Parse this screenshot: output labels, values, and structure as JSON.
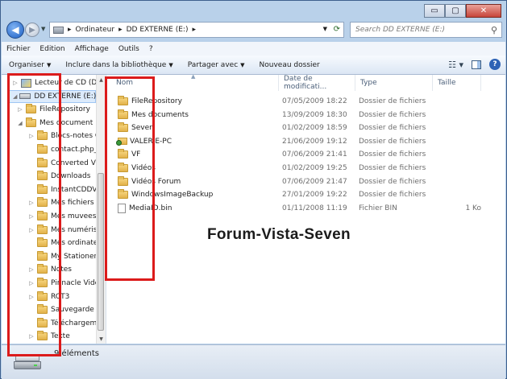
{
  "window": {
    "caption_buttons": {
      "minimize": "▭",
      "maximize": "▢",
      "close": "✕"
    }
  },
  "address_bar": {
    "crumbs": [
      "Ordinateur",
      "DD EXTERNE (E:)"
    ],
    "separator": "▸",
    "search_placeholder": "Search DD EXTERNE (E:)"
  },
  "menu": [
    "Fichier",
    "Edition",
    "Affichage",
    "Outils",
    "?"
  ],
  "commands": [
    {
      "label": "Organiser",
      "dropdown": true
    },
    {
      "label": "Inclure dans la bibliothèque",
      "dropdown": true
    },
    {
      "label": "Partager avec",
      "dropdown": true
    },
    {
      "label": "Nouveau dossier",
      "dropdown": false
    }
  ],
  "nav_tree": [
    {
      "label": "Lecteur de CD (D",
      "icon": "cd-drive",
      "indent": 0,
      "expander": "▷",
      "selected": false
    },
    {
      "label": "DD EXTERNE (E:)",
      "icon": "external-drive",
      "indent": 0,
      "expander": "◢",
      "selected": true
    },
    {
      "label": "FileRepository",
      "icon": "folder",
      "indent": 1,
      "expander": "▷",
      "selected": false
    },
    {
      "label": "Mes document",
      "icon": "folder",
      "indent": 1,
      "expander": "◢",
      "selected": false
    },
    {
      "label": "Blocs-notes C",
      "icon": "folder",
      "indent": 2,
      "expander": "▷",
      "selected": false
    },
    {
      "label": "contact.php_",
      "icon": "folder",
      "indent": 2,
      "expander": "",
      "selected": false
    },
    {
      "label": "Converted Vi",
      "icon": "folder",
      "indent": 2,
      "expander": "",
      "selected": false
    },
    {
      "label": "Downloads",
      "icon": "folder",
      "indent": 2,
      "expander": "",
      "selected": false
    },
    {
      "label": "InstantCDDVI",
      "icon": "folder",
      "indent": 2,
      "expander": "",
      "selected": false
    },
    {
      "label": "Mes fichiers r",
      "icon": "folder",
      "indent": 2,
      "expander": "▷",
      "selected": false
    },
    {
      "label": "Mes muvees",
      "icon": "folder",
      "indent": 2,
      "expander": "▷",
      "selected": false
    },
    {
      "label": "Mes numéris",
      "icon": "folder",
      "indent": 2,
      "expander": "▷",
      "selected": false
    },
    {
      "label": "Mes ordinate",
      "icon": "folder",
      "indent": 2,
      "expander": "",
      "selected": false
    },
    {
      "label": "My Stationer",
      "icon": "folder",
      "indent": 2,
      "expander": "",
      "selected": false
    },
    {
      "label": "Notes",
      "icon": "folder",
      "indent": 2,
      "expander": "▷",
      "selected": false
    },
    {
      "label": "Pinnacle Vide",
      "icon": "folder",
      "indent": 2,
      "expander": "▷",
      "selected": false
    },
    {
      "label": "RCT3",
      "icon": "folder",
      "indent": 2,
      "expander": "▷",
      "selected": false
    },
    {
      "label": "Sauvegarde r",
      "icon": "folder",
      "indent": 2,
      "expander": "",
      "selected": false
    },
    {
      "label": "Téléchargem",
      "icon": "folder",
      "indent": 2,
      "expander": "",
      "selected": false
    },
    {
      "label": "Texte",
      "icon": "folder",
      "indent": 2,
      "expander": "▷",
      "selected": false
    }
  ],
  "columns": [
    "Nom",
    "Date de modificati...",
    "Type",
    "Taille"
  ],
  "files": [
    {
      "name": "FileRepository",
      "date": "07/05/2009 18:22",
      "type": "Dossier de fichiers",
      "size": "",
      "icon": "folder"
    },
    {
      "name": "Mes documents",
      "date": "13/09/2009 18:30",
      "type": "Dossier de fichiers",
      "size": "",
      "icon": "folder"
    },
    {
      "name": "Seven",
      "date": "01/02/2009 18:59",
      "type": "Dossier de fichiers",
      "size": "",
      "icon": "folder"
    },
    {
      "name": "VALERIE-PC",
      "date": "21/06/2009 19:12",
      "type": "Dossier de fichiers",
      "size": "",
      "icon": "network-folder"
    },
    {
      "name": "VF",
      "date": "07/06/2009 21:41",
      "type": "Dossier de fichiers",
      "size": "",
      "icon": "folder"
    },
    {
      "name": "Vidéos",
      "date": "01/02/2009 19:25",
      "type": "Dossier de fichiers",
      "size": "",
      "icon": "folder"
    },
    {
      "name": "Vidéos Forum",
      "date": "07/06/2009 21:47",
      "type": "Dossier de fichiers",
      "size": "",
      "icon": "folder"
    },
    {
      "name": "WindowsImageBackup",
      "date": "27/01/2009 19:22",
      "type": "Dossier de fichiers",
      "size": "",
      "icon": "folder"
    },
    {
      "name": "MediaID.bin",
      "date": "01/11/2008 11:19",
      "type": "Fichier BIN",
      "size": "1 Ko",
      "icon": "file"
    }
  ],
  "watermark": "Forum-Vista-Seven",
  "status": {
    "item_count": "9 éléments"
  },
  "colors": {
    "annotation_red": "#dc1b1b",
    "selection": "#dcebfc",
    "chrome": "#b9d1ea"
  }
}
